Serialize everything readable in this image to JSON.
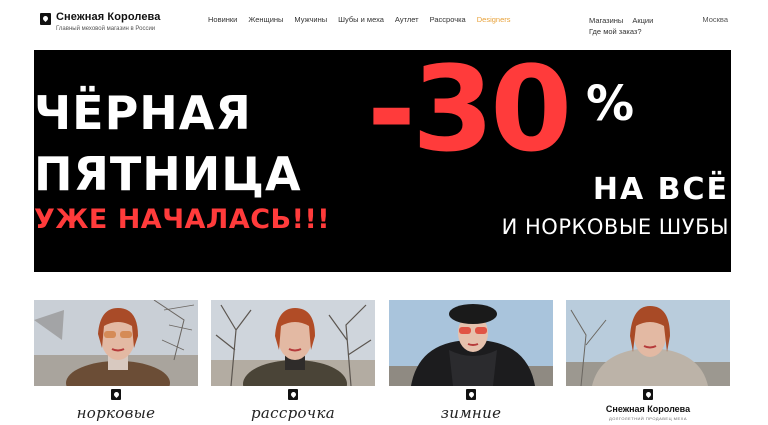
{
  "header": {
    "logo_title": "Снежная Королева",
    "logo_subtitle": "Главный меховой магазин в России",
    "nav": [
      {
        "label": "Новинки"
      },
      {
        "label": "Женщины"
      },
      {
        "label": "Мужчины"
      },
      {
        "label": "Шубы и меха"
      },
      {
        "label": "Аутлет"
      },
      {
        "label": "Рассрочка"
      },
      {
        "label": "Designers",
        "accent": "#e8a23a"
      }
    ],
    "util": {
      "stores": "Магазины",
      "promos": "Акции",
      "order_status": "Где мой заказ?"
    },
    "city": "Москва"
  },
  "banner": {
    "line1": "ЧЁРНАЯ",
    "line2": "ПЯТНИЦА",
    "line3": "УЖЕ НАЧАЛАСЬ!!!",
    "discount": "-30",
    "percent": "%",
    "all": "НА ВСЁ",
    "fur": "И НОРКОВЫЕ ШУБЫ",
    "accent_color": "#ff3b3b",
    "background": "#000000"
  },
  "cards": [
    {
      "label": "норковые",
      "image": "woman-fur-coat-photo"
    },
    {
      "label": "рассрочка",
      "image": "woman-fur-coat-photo"
    },
    {
      "label": "зимние",
      "image": "woman-down-jacket-photo"
    },
    {
      "brand": "Снежная Королева",
      "brand_sub": "ДОЛГОЛЕТНИЙ ПРОДАВЕЦ МЕХА",
      "image": "woman-coat-photo"
    }
  ]
}
